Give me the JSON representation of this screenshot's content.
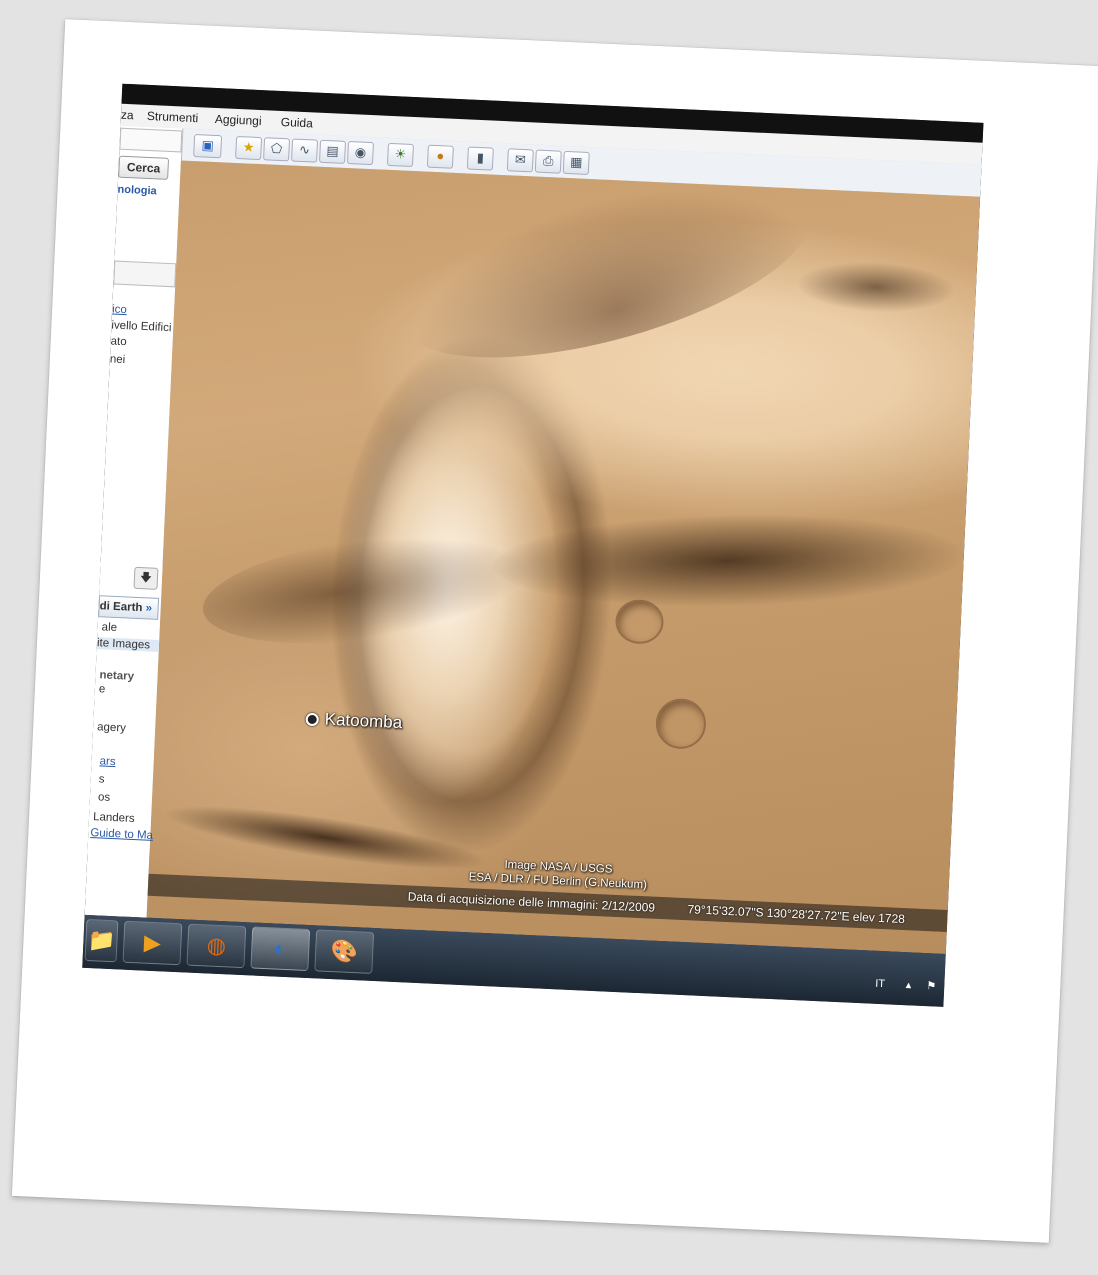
{
  "menu": {
    "item0": "za",
    "item1": "Strumenti",
    "item2": "Aggiungi",
    "item3": "Guida"
  },
  "search": {
    "button": "Cerca",
    "link": "nologia"
  },
  "layers": {
    "l1": "ico",
    "l2": "ivello Edifici",
    "l3": "ato",
    "l4": "nei"
  },
  "sidebar": {
    "earth_button": "di Earth",
    "items": [
      "ale",
      "ite Images",
      "netary",
      "e",
      "agery",
      "ars",
      "s",
      "os",
      "Landers",
      "Guide to Ma"
    ]
  },
  "map": {
    "place_label": "Katoomba",
    "credit_line1": "Image NASA / USGS",
    "credit_line2": "ESA / DLR / FU Berlin (G.Neukum)",
    "acquisition": "Data di acquisizione delle immagini: 2/12/2009",
    "coords": "79°15'32.07\"S  130°28'27.72\"E  elev  1728"
  },
  "tray": {
    "lang": "IT"
  },
  "icons": [
    "sidebar-toggle-icon",
    "placemark-icon",
    "polygon-icon",
    "path-icon",
    "overlay-icon",
    "tour-icon",
    "sunlight-icon",
    "planet-icon",
    "ruler-icon",
    "email-icon",
    "print-icon",
    "save-image-icon"
  ]
}
